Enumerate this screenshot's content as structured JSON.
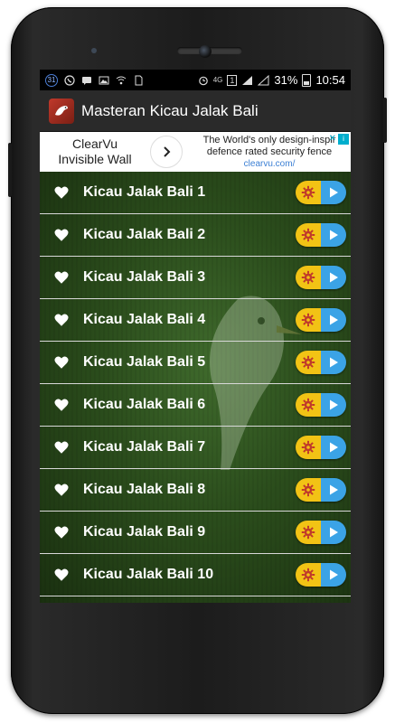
{
  "status_bar": {
    "notification_count": "31",
    "network": "4G",
    "sim": "1",
    "battery": "31%",
    "time": "10:54"
  },
  "app": {
    "title": "Masteran Kicau Jalak Bali",
    "icon": "bird-app-icon"
  },
  "ad": {
    "left_line1": "ClearVu",
    "left_line2": "Invisible Wall",
    "right_line1": "The World's only design-inspir",
    "right_line2": "defence rated security fence",
    "url": "clearvu.com/",
    "badge": "i",
    "close": "✕"
  },
  "list": {
    "items": [
      {
        "label": "Kicau Jalak Bali 1"
      },
      {
        "label": "Kicau Jalak Bali 2"
      },
      {
        "label": "Kicau Jalak Bali 3"
      },
      {
        "label": "Kicau Jalak Bali 4"
      },
      {
        "label": "Kicau Jalak Bali 5"
      },
      {
        "label": "Kicau Jalak Bali 6"
      },
      {
        "label": "Kicau Jalak Bali 7"
      },
      {
        "label": "Kicau Jalak Bali 8"
      },
      {
        "label": "Kicau Jalak Bali 9"
      },
      {
        "label": "Kicau Jalak Bali 10"
      }
    ]
  },
  "colors": {
    "list_background": "#2f5a20",
    "settings_button": "#f2c315",
    "play_button": "#3ba3e6",
    "gear_icon": "#c0392b"
  }
}
